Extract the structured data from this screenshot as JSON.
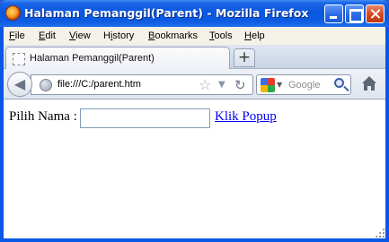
{
  "window": {
    "title": "Halaman Pemanggil(Parent) - Mozilla Firefox"
  },
  "menu": [
    {
      "underline": "F",
      "rest": "ile"
    },
    {
      "underline": "E",
      "rest": "dit"
    },
    {
      "underline": "V",
      "rest": "iew"
    },
    {
      "underline": "Hi",
      "pre": "",
      "rest": "story"
    },
    {
      "underline": "B",
      "rest": "ookmarks"
    },
    {
      "underline": "T",
      "rest": "ools"
    },
    {
      "underline": "H",
      "rest": "elp"
    }
  ],
  "tabs": [
    {
      "label": "Halaman Pemanggil(Parent)"
    }
  ],
  "new_tab_label": "+",
  "navbar": {
    "url": "file:///C:/parent.htm",
    "search_placeholder": "Google"
  },
  "page": {
    "label": "Pilih Nama :",
    "input_value": "",
    "link_text": "Klik Popup"
  },
  "colors": {
    "titlebar": "#0a58e0",
    "link": "#0000ee",
    "close_button": "#d4481c"
  },
  "icons": [
    "firefox-logo-icon",
    "minimize-icon",
    "maximize-icon",
    "close-icon",
    "page-favicon-icon",
    "new-tab-icon",
    "back-arrow-icon",
    "globe-icon",
    "bookmark-star-icon",
    "history-dropdown-icon",
    "reload-icon",
    "google-icon",
    "search-engine-dropdown-icon",
    "magnifier-icon",
    "home-icon",
    "resize-grip-icon"
  ]
}
